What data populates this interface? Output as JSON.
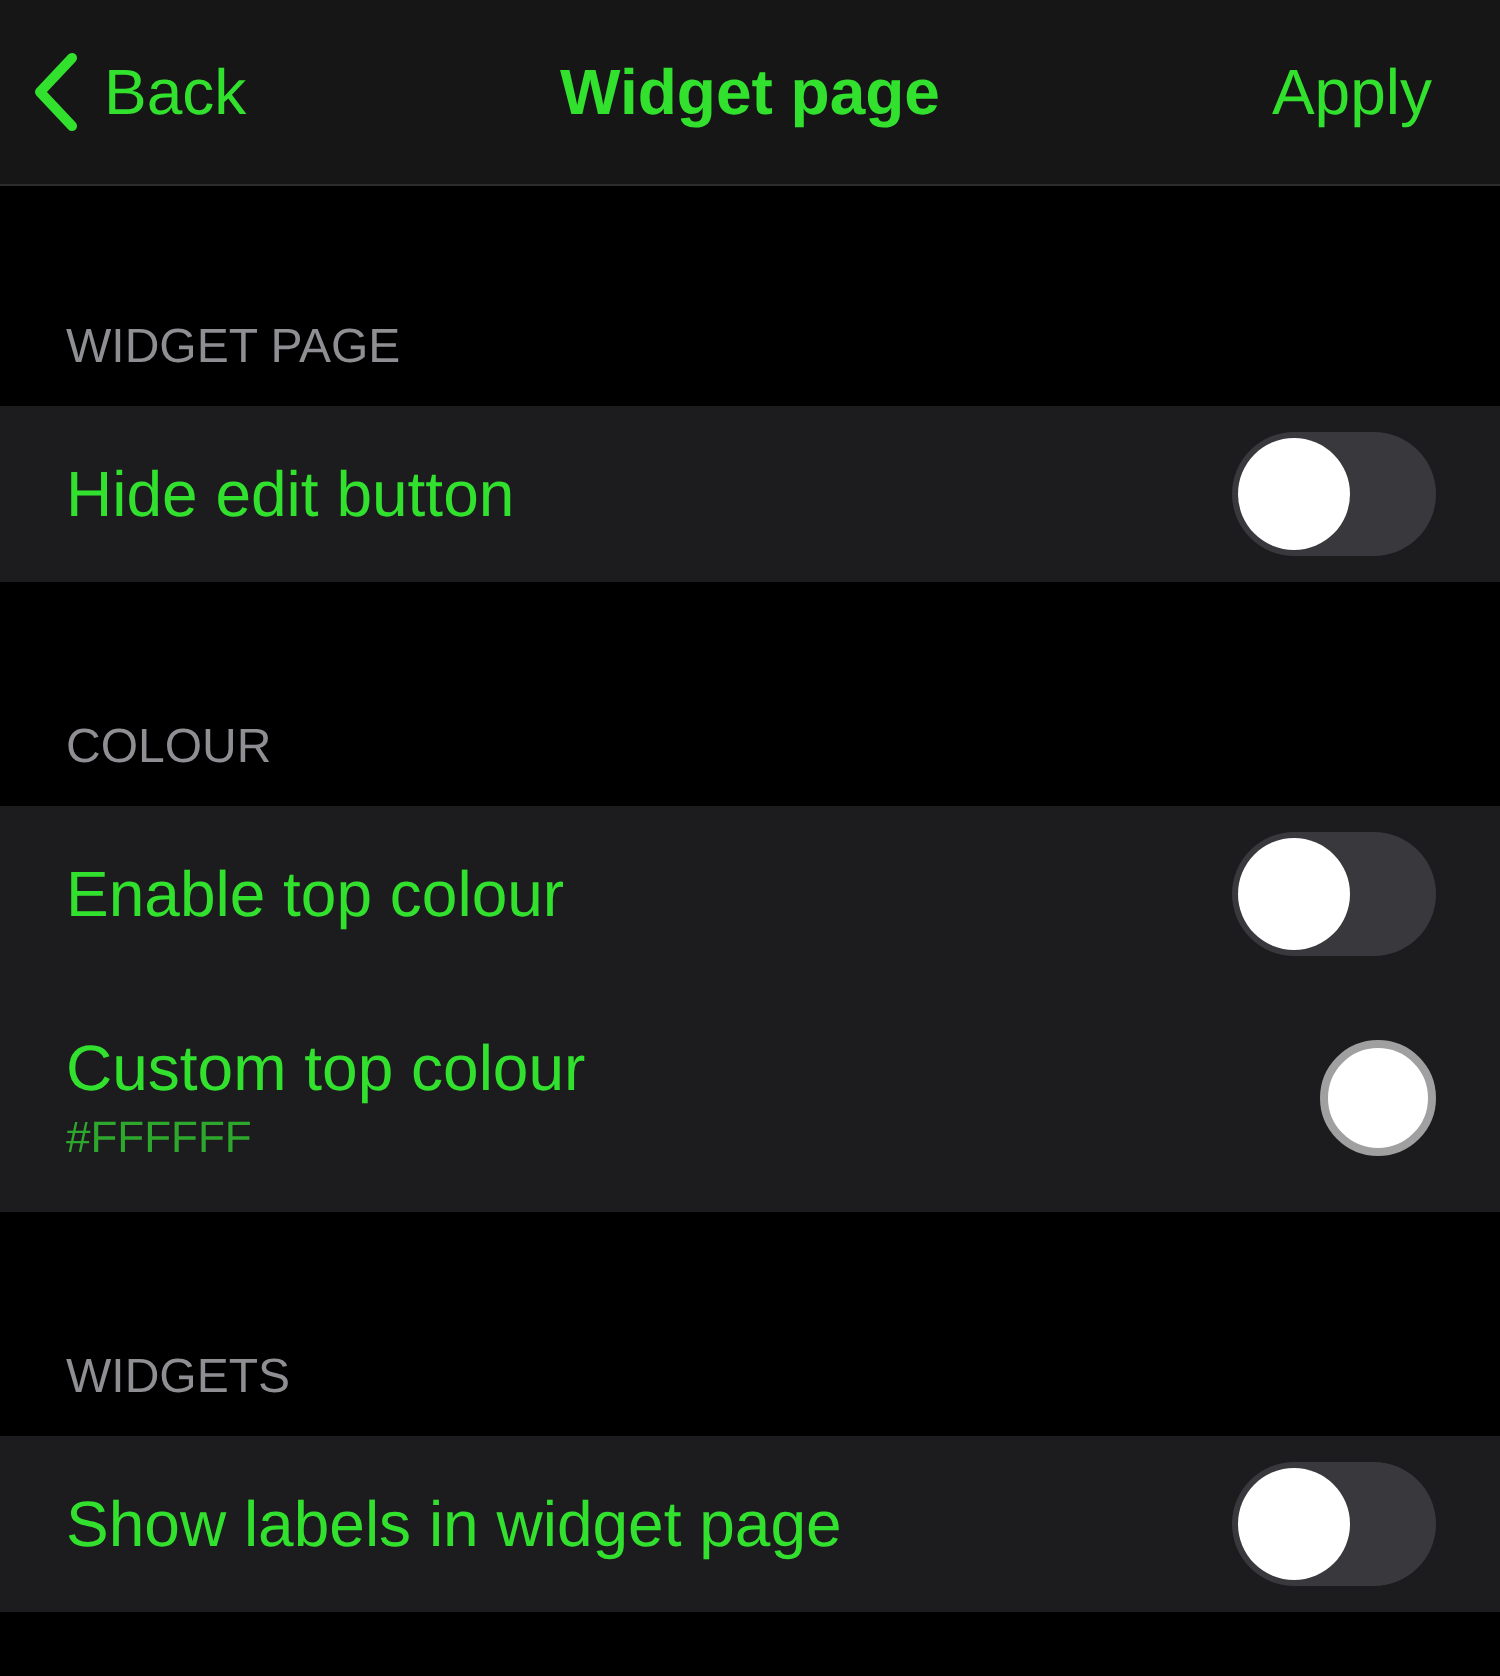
{
  "nav": {
    "back": "Back",
    "title": "Widget page",
    "action": "Apply"
  },
  "sections": [
    {
      "header": "WIDGET PAGE",
      "rows": [
        {
          "kind": "toggle",
          "label": "Hide edit button",
          "on": false
        }
      ]
    },
    {
      "header": "COLOUR",
      "rows": [
        {
          "kind": "toggle",
          "label": "Enable top colour",
          "on": false
        },
        {
          "kind": "color",
          "label": "Custom top colour",
          "value": "#FFFFFF",
          "color": "#ffffff"
        }
      ]
    },
    {
      "header": "WIDGETS",
      "rows": [
        {
          "kind": "toggle",
          "label": "Show labels in widget page",
          "on": false
        }
      ]
    }
  ]
}
